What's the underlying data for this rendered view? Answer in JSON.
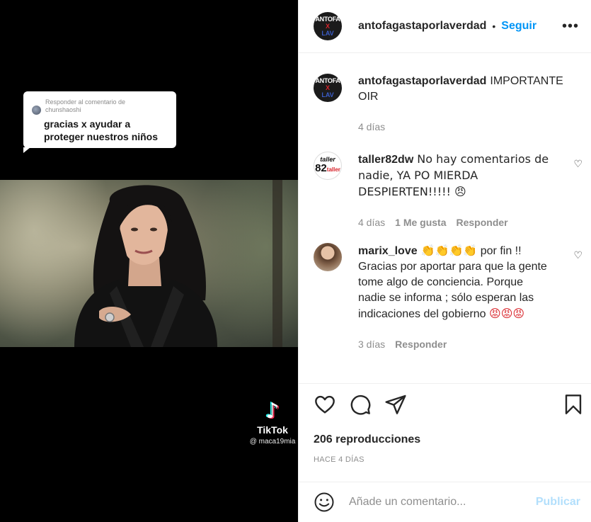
{
  "media": {
    "reply_meta_line1": "Responder al comentario de",
    "reply_meta_line2": "chunshaoshi",
    "reply_text_line1": "gracias x ayudar a",
    "reply_text_line2": "proteger nuestros niños",
    "tiktok_logo": "♪",
    "tiktok_name": "TikTok",
    "tiktok_handle": "@ maca19mia"
  },
  "header": {
    "avatar_line1": "ANTOFA",
    "avatar_x": "X",
    "avatar_line2": "LAV",
    "username": "antofagastaporlaverdad",
    "dot": "•",
    "follow_label": "Seguir",
    "more_icon": "•••"
  },
  "caption": {
    "username": "antofagastaporlaverdad",
    "text_line1": "IMPORTANTE",
    "text_line2": "OIR",
    "time": "4 días"
  },
  "comments": [
    {
      "avatar_top": "taller",
      "avatar_num": "82",
      "avatar_side": "taller",
      "username": "taller82dw",
      "text": "No hay comentarios de nadie, YA PO MIERDA DESPIERTEN!!!!! 😠",
      "time": "4 días",
      "likes": "1 Me gusta",
      "reply": "Responder",
      "like_icon": "♡"
    },
    {
      "username": "marix_love",
      "emoji_clap": "👏👏👏👏",
      "text": "por fin !! Gracias por aportar para que la gente tome algo de conciencia. Porque nadie se informa ; sólo esperan las indicaciones del gobierno",
      "emoji_angry": "😡😡😡",
      "time": "3 días",
      "reply": "Responder",
      "like_icon": "♡"
    }
  ],
  "views": "206 reproducciones",
  "ago": "HACE 4 DÍAS",
  "add_comment": {
    "placeholder": "Añade un comentario...",
    "publish_label": "Publicar"
  },
  "colors": {
    "accent": "#0095f6",
    "publish_disabled": "#b2dffc",
    "muted": "#8e8e8e"
  },
  "icons": [
    "heart-icon",
    "comment-icon",
    "share-icon",
    "bookmark-icon",
    "smiley-icon",
    "more-options-icon",
    "tiktok-logo-icon"
  ]
}
